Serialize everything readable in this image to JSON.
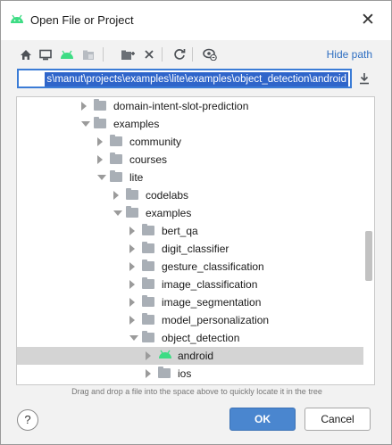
{
  "window": {
    "title": "Open File or Project",
    "close_glyph": "✕"
  },
  "toolbar": {
    "icons": [
      "home-icon",
      "desktop-icon",
      "android-project-icon",
      "module-icon",
      "new-folder-icon",
      "delete-icon",
      "refresh-icon",
      "show-hidden-icon"
    ],
    "hide_path_label": "Hide path"
  },
  "path": {
    "value": "s\\manut\\projects\\examples\\lite\\examples\\object_detection\\android"
  },
  "tree": {
    "rows": [
      {
        "label": "domain-intent-slot-prediction",
        "state": "closed",
        "icon": "folder"
      },
      {
        "label": "examples",
        "state": "open",
        "icon": "folder"
      },
      {
        "label": "community",
        "state": "closed",
        "icon": "folder"
      },
      {
        "label": "courses",
        "state": "closed",
        "icon": "folder"
      },
      {
        "label": "lite",
        "state": "open",
        "icon": "folder"
      },
      {
        "label": "codelabs",
        "state": "closed",
        "icon": "folder"
      },
      {
        "label": "examples",
        "state": "open",
        "icon": "folder"
      },
      {
        "label": "bert_qa",
        "state": "closed",
        "icon": "folder"
      },
      {
        "label": "digit_classifier",
        "state": "closed",
        "icon": "folder"
      },
      {
        "label": "gesture_classification",
        "state": "closed",
        "icon": "folder"
      },
      {
        "label": "image_classification",
        "state": "closed",
        "icon": "folder"
      },
      {
        "label": "image_segmentation",
        "state": "closed",
        "icon": "folder"
      },
      {
        "label": "model_personalization",
        "state": "closed",
        "icon": "folder"
      },
      {
        "label": "object_detection",
        "state": "open",
        "icon": "folder"
      },
      {
        "label": "android",
        "state": "closed",
        "icon": "android",
        "selected": true
      },
      {
        "label": "ios",
        "state": "closed",
        "icon": "folder"
      }
    ]
  },
  "hint": "Drag and drop a file into the space above to quickly locate it in the tree",
  "buttons": {
    "help": "?",
    "ok": "OK",
    "cancel": "Cancel"
  },
  "colors": {
    "accent": "#4a86cf",
    "android_green": "#3ddc84",
    "selection": "#2f65ca"
  }
}
